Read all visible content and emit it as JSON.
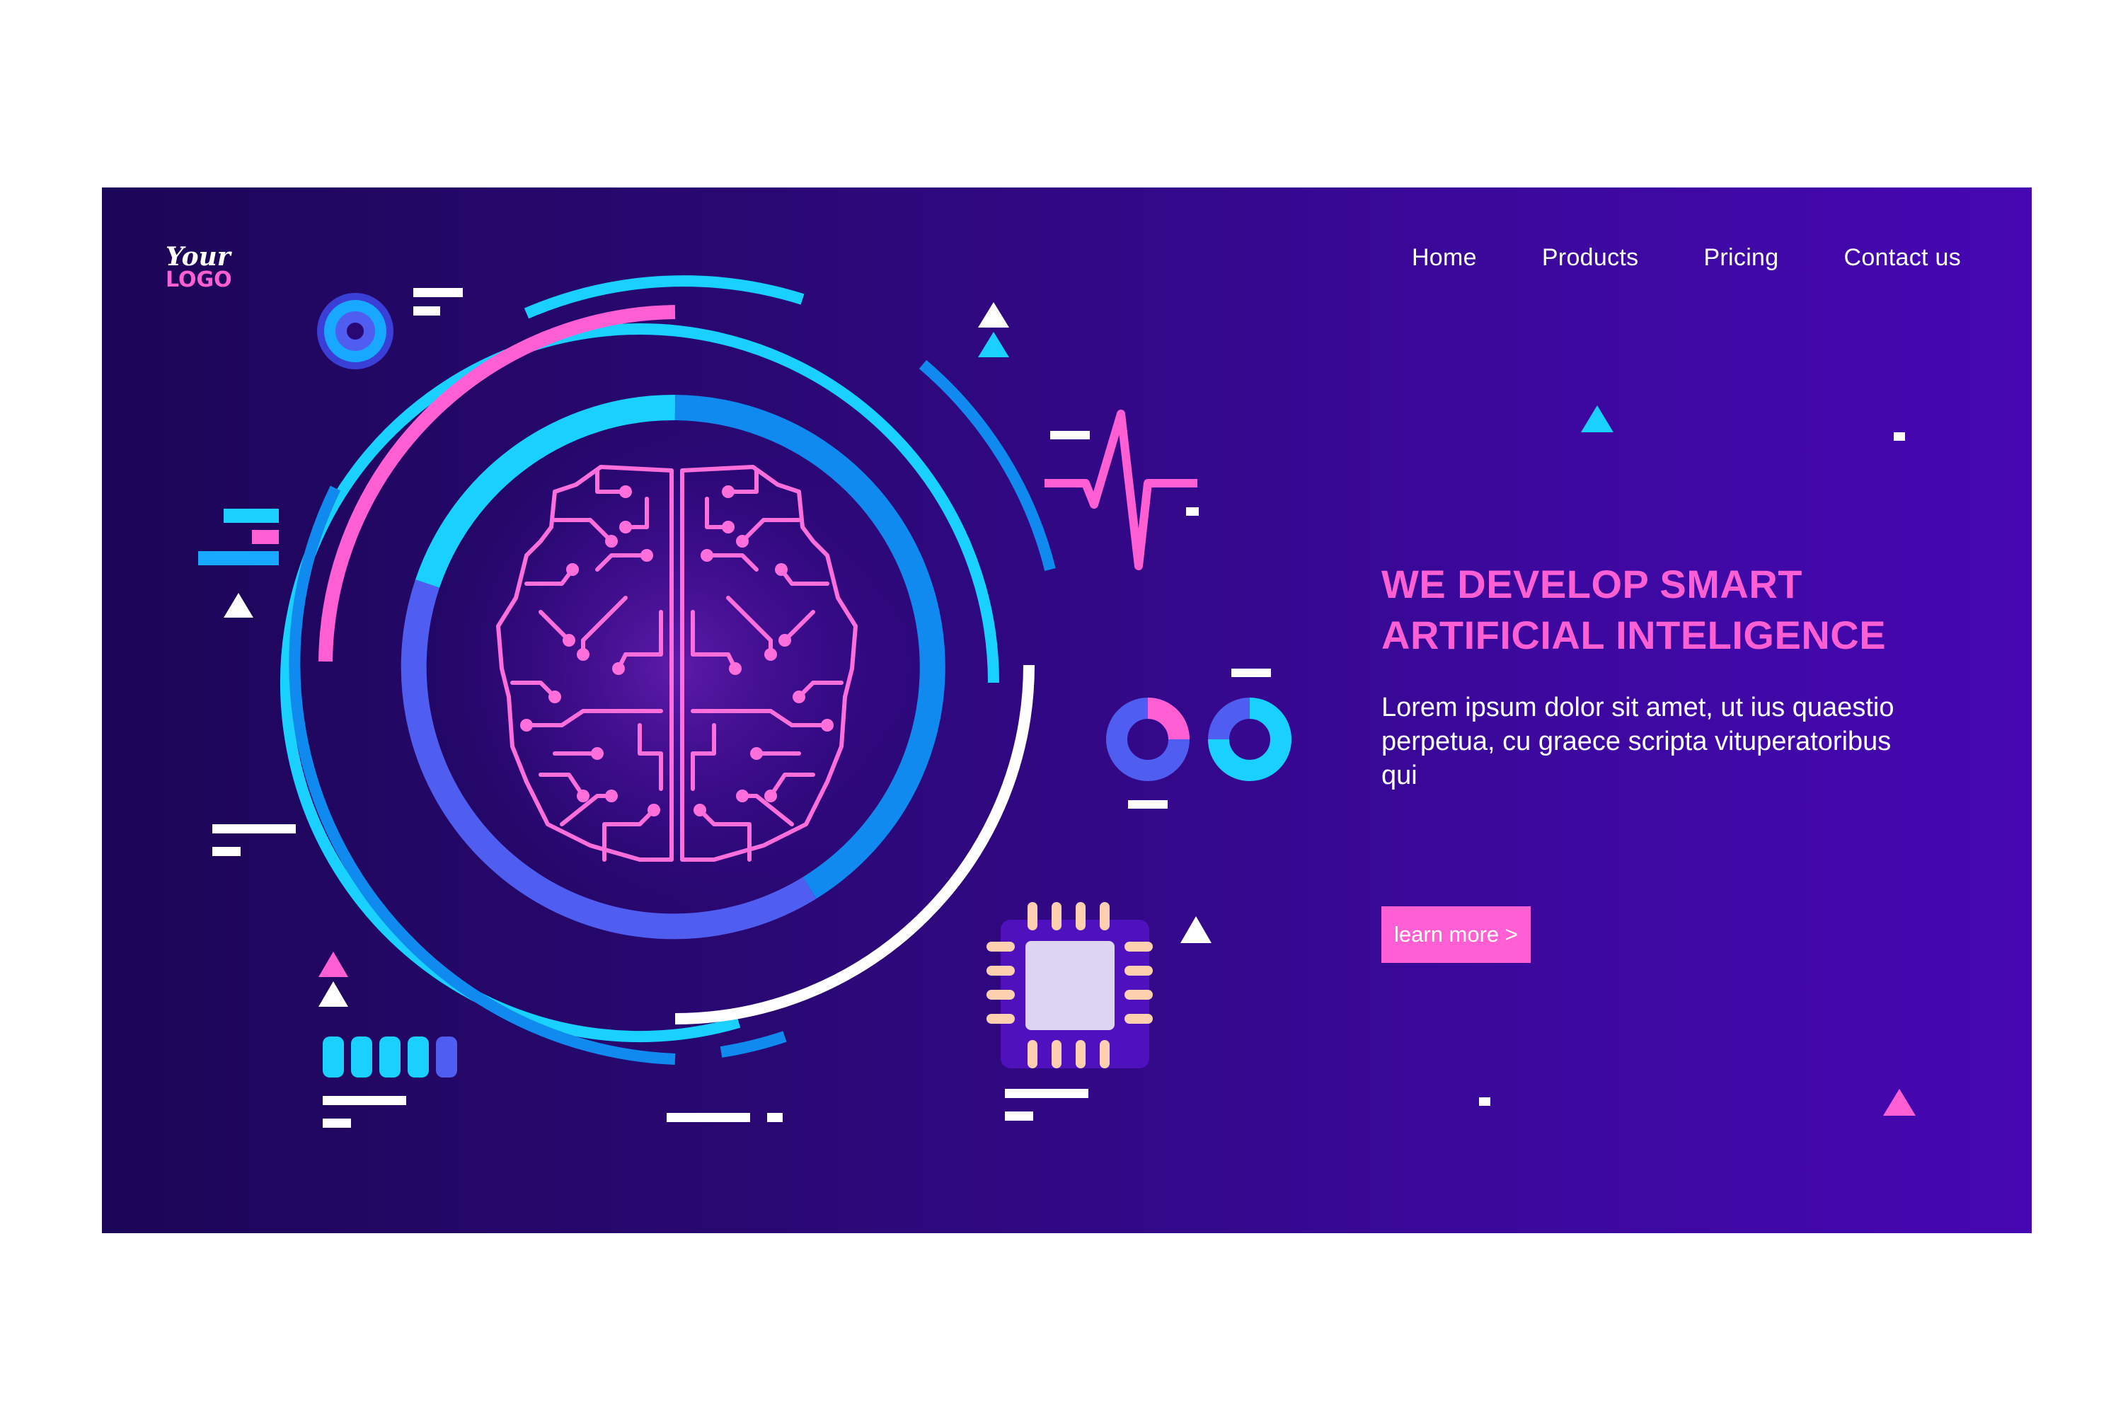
{
  "logo": {
    "line1": "Your",
    "line2": "LOGO"
  },
  "nav": {
    "items": [
      {
        "label": "Home"
      },
      {
        "label": "Products"
      },
      {
        "label": "Pricing"
      },
      {
        "label": "Contact us"
      }
    ]
  },
  "hero": {
    "headline_line1": "WE DEVELOP SMART",
    "headline_line2": "ARTIFICIAL INTELIGENCE",
    "body": "Lorem ipsum dolor sit amet, ut ius quaestio perpetua, cu graece scripta vituperatoribus qui",
    "cta_label": "learn more >"
  },
  "colors": {
    "accent_pink": "#ff5fd2",
    "accent_cyan": "#19d0ff",
    "accent_blue": "#118af0",
    "background_start": "#1c0657",
    "background_end": "#4607b2"
  },
  "illustration": {
    "icons": [
      "brain-circuit-icon",
      "gear-icon",
      "heartbeat-icon",
      "cpu-chip-icon",
      "donut-chart-icon",
      "battery-cells-icon"
    ]
  }
}
